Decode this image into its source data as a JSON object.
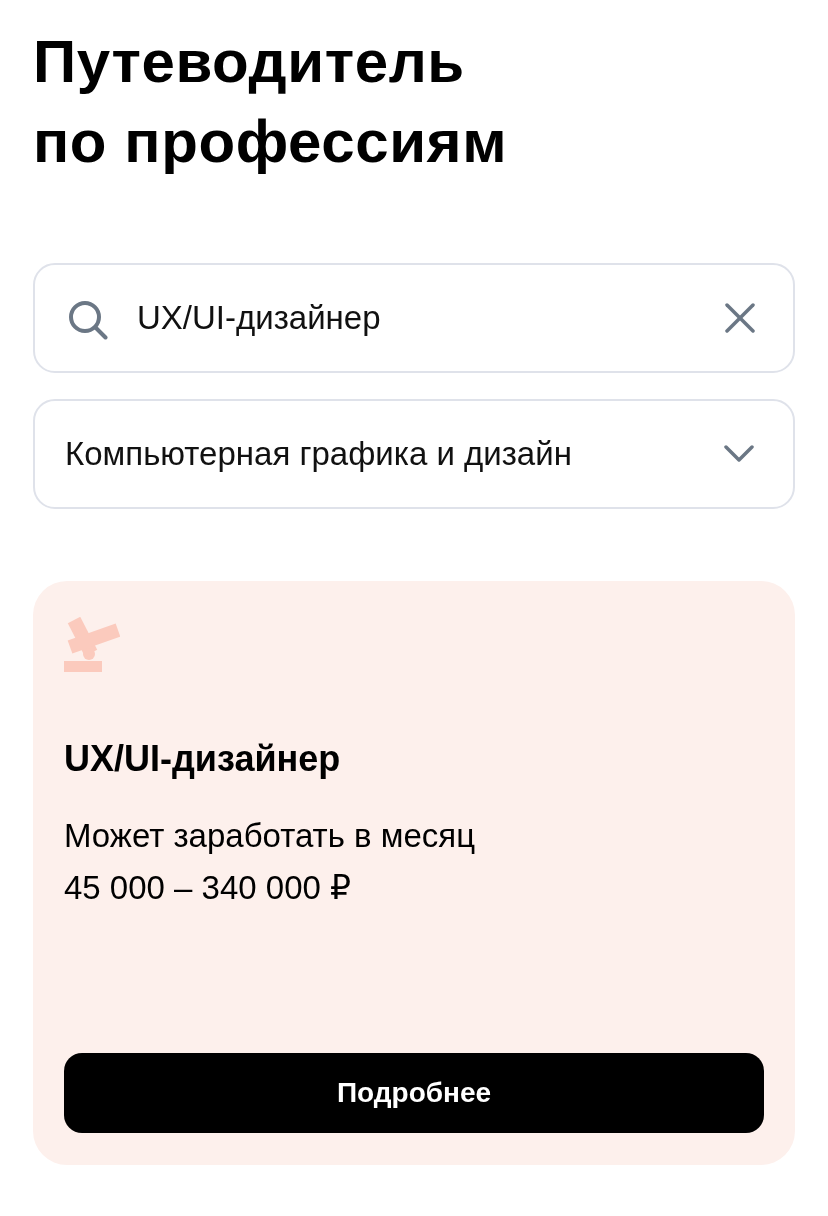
{
  "title": "Путеводитель по профессиям",
  "search": {
    "value": "UX/UI-дизайнер"
  },
  "category_select": {
    "value": "Компьютерная графика и дизайн",
    "expanded": false
  },
  "profession_card": {
    "title": "UX/UI-дизайнер",
    "salary_label": "Может заработать в месяц",
    "salary_range": "45 000 – 340 000 ₽",
    "button": "Подробнее"
  }
}
